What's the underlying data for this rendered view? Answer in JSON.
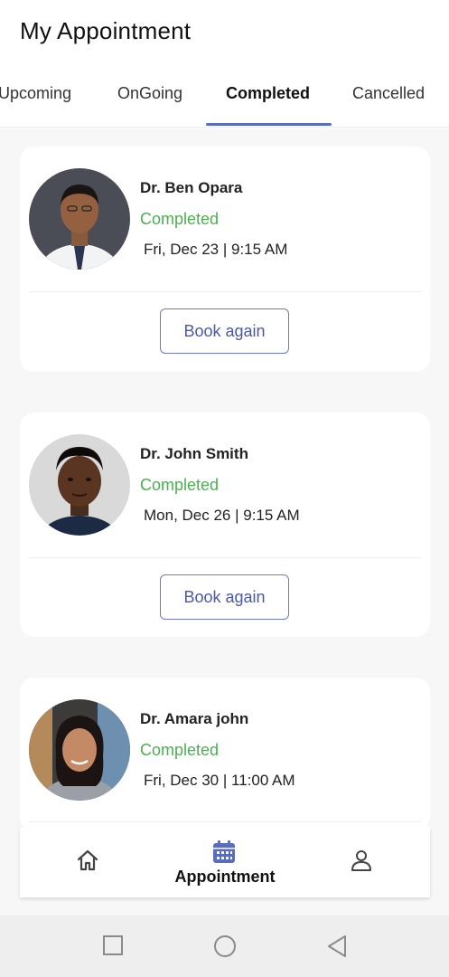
{
  "header": {
    "title": "My Appointment"
  },
  "tabs": [
    {
      "label": "Upcoming"
    },
    {
      "label": "OnGoing"
    },
    {
      "label": "Completed",
      "active": true
    },
    {
      "label": "Cancelled"
    }
  ],
  "appointments": [
    {
      "doctor": "Dr. Ben Opara",
      "status": "Completed",
      "datetime": "Fri, Dec 23 | 9:15 AM",
      "action": "Book again"
    },
    {
      "doctor": "Dr. John Smith",
      "status": "Completed",
      "datetime": "Mon, Dec 26 | 9:15 AM",
      "action": "Book again"
    },
    {
      "doctor": "Dr. Amara john",
      "status": "Completed",
      "datetime": "Fri, Dec 30 | 11:00 AM"
    }
  ],
  "bottom_nav": {
    "items": [
      {
        "icon": "home-icon"
      },
      {
        "icon": "calendar-icon",
        "label": "Appointment",
        "active": true
      },
      {
        "icon": "profile-icon"
      }
    ]
  },
  "system_nav": {
    "icons": [
      "recents-square-icon",
      "home-circle-icon",
      "back-triangle-icon"
    ]
  },
  "colors": {
    "accent": "#5a6cbf",
    "status_completed": "#4caf50",
    "background": "#f7f7f8"
  }
}
